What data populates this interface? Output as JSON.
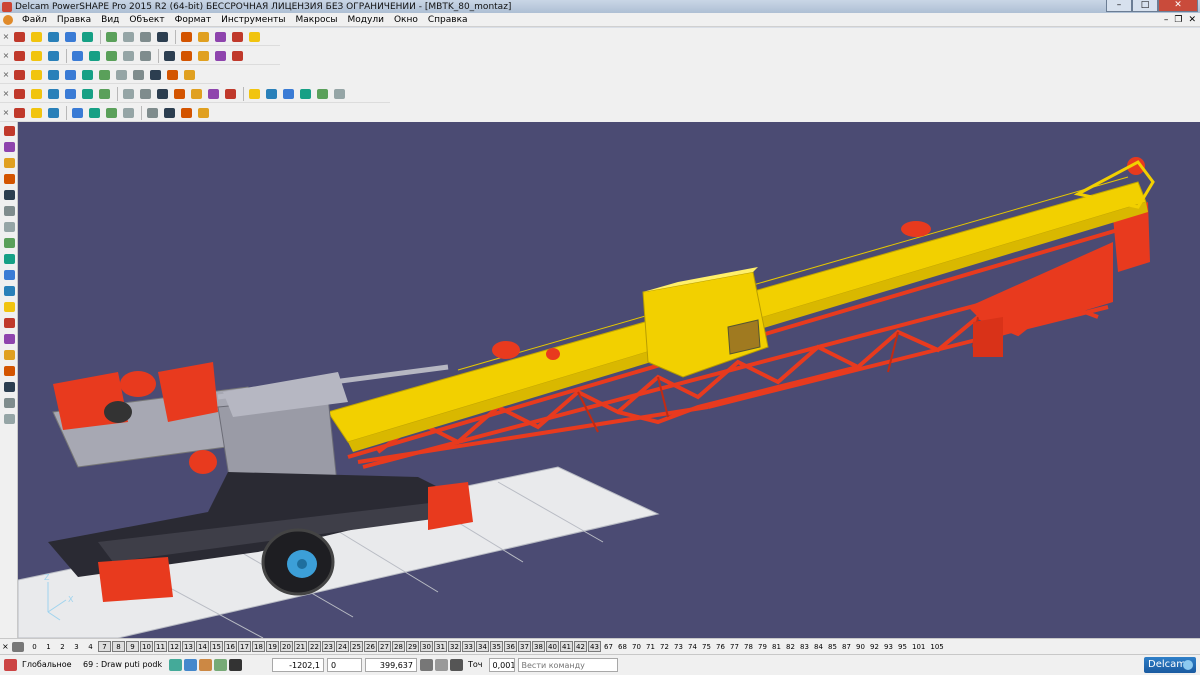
{
  "window": {
    "title": "Delcam PowerSHAPE Pro 2015 R2 (64-bit) БЕССРОЧНАЯ ЛИЦЕНЗИЯ БЕЗ ОГРАНИЧЕНИЙ - [MBTK_80_montaz]"
  },
  "menu": {
    "items": [
      "Файл",
      "Правка",
      "Вид",
      "Объект",
      "Формат",
      "Инструменты",
      "Макросы",
      "Модули",
      "Окно",
      "Справка"
    ]
  },
  "levels": {
    "items": [
      "0",
      "1",
      "2",
      "3",
      "4",
      "7",
      "8",
      "9",
      "10",
      "11",
      "12",
      "13",
      "14",
      "15",
      "16",
      "17",
      "18",
      "19",
      "20",
      "21",
      "22",
      "23",
      "24",
      "25",
      "26",
      "27",
      "28",
      "29",
      "30",
      "31",
      "32",
      "33",
      "34",
      "35",
      "36",
      "37",
      "38",
      "40",
      "41",
      "42",
      "43",
      "67",
      "68",
      "70",
      "71",
      "72",
      "73",
      "74",
      "75",
      "76",
      "77",
      "78",
      "79",
      "81",
      "82",
      "83",
      "84",
      "85",
      "87",
      "90",
      "92",
      "93",
      "95",
      "101",
      "105"
    ],
    "active": [
      "7",
      "8",
      "9",
      "10",
      "11",
      "12",
      "13",
      "14",
      "15",
      "16",
      "17",
      "18",
      "19",
      "20",
      "21",
      "22",
      "23",
      "24",
      "25",
      "26",
      "27",
      "28",
      "29",
      "30",
      "31",
      "32",
      "33",
      "34",
      "35",
      "36",
      "37",
      "38",
      "40",
      "41",
      "42",
      "43"
    ]
  },
  "status": {
    "workplane": "Глобальное",
    "level": "69 : Draw puti podk",
    "x": "-1202,1",
    "y": "0",
    "z": "399,637",
    "tolerance_label": "Точ",
    "tolerance": "0,001",
    "command_placeholder": "Вести команду"
  },
  "viewport": {
    "background": "#4b4b73",
    "axis_x": "X",
    "axis_z": "Z"
  },
  "brand": "Delcam"
}
